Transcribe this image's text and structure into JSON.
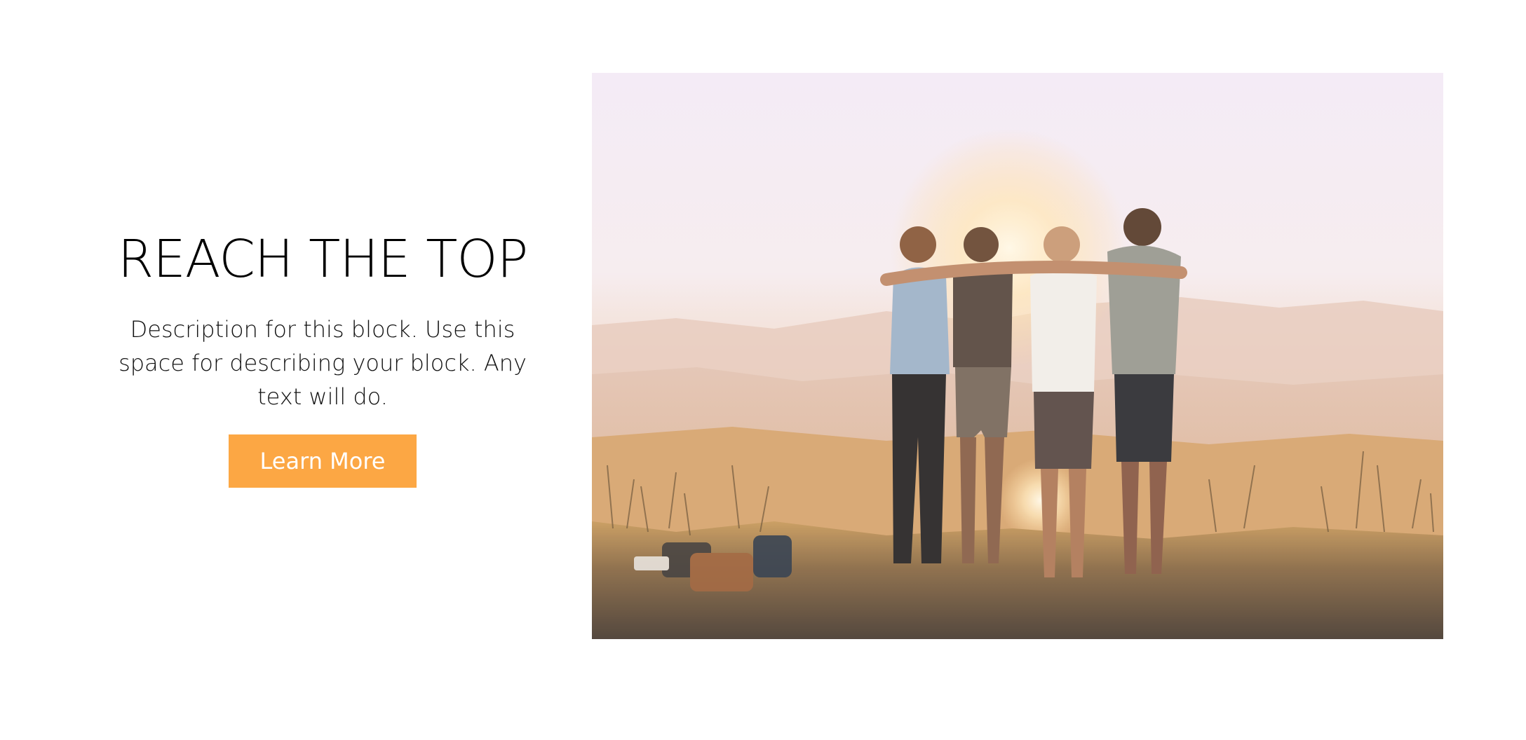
{
  "hero": {
    "title": "REACH THE TOP",
    "description": "Description for this block. Use this space for describing your block. Any text will do.",
    "button_label": "Learn More"
  },
  "colors": {
    "accent": "#fca744",
    "background": "#ffffff",
    "text": "#111111"
  },
  "image": {
    "subject": "group-photo-sunset-hilltop"
  }
}
